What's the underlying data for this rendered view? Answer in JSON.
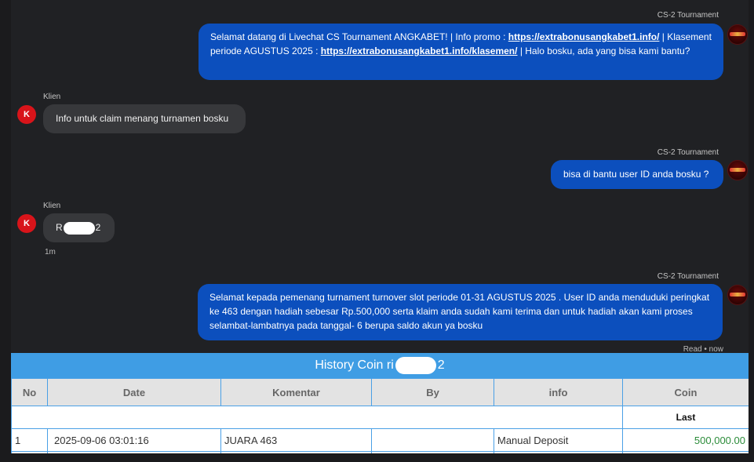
{
  "chat": {
    "messages": [
      {
        "role": "agent",
        "sender": "CS-2 Tournament",
        "parts": {
          "p1": "Selamat datang di Livechat CS Tournament ANGKABET! | Info promo : ",
          "link1": "https://extrabonusangkabet1.info/",
          "p2": " | Klasement periode AGUSTUS 2025 : ",
          "link2": "https://extrabonusangkabet1.info/klasemen/",
          "p3": " | Halo bosku, ada yang bisa kami bantu?"
        }
      },
      {
        "role": "client",
        "sender": "Klien",
        "avatar": "K",
        "text": "Info untuk claim menang turnamen bosku"
      },
      {
        "role": "agent",
        "sender": "CS-2 Tournament",
        "text": "bisa di bantu user ID anda bosku ?"
      },
      {
        "role": "client",
        "sender": "Klien",
        "avatar": "K",
        "text_start": "R",
        "text_end": "2",
        "time": "1m"
      },
      {
        "role": "agent",
        "sender": "CS-2 Tournament",
        "text": "Selamat kepada pemenang turnament turnover slot periode 01-31 AGUSTUS 2025 . User ID anda menduduki peringkat ke 463 dengan hadiah sebesar Rp.500,000 serta klaim anda sudah kami terima dan untuk hadiah akan kami proses selambat-lambatnya pada tanggal- 6 berupa saldo akun ya bosku",
        "status": "Read • now"
      }
    ]
  },
  "history": {
    "title_start": "History Coin ri",
    "title_end": "2",
    "columns": [
      "No",
      "Date",
      "Komentar",
      "By",
      "info",
      "Coin"
    ],
    "last_label": "Last",
    "rows": [
      {
        "no": "1",
        "date": "2025-09-06 03:01:16",
        "komentar": "JUARA 463",
        "by": "",
        "info": "Manual Deposit",
        "coin": "500,000.00"
      }
    ]
  },
  "colors": {
    "agent_bubble": "#0c4fbd",
    "client_bubble": "#37383b",
    "header_bar": "#3f9de4",
    "coin_positive": "#2c8c3a",
    "client_avatar": "#d8141a"
  },
  "icons": {
    "agent_avatar": "angkabet-logo-icon",
    "client_avatar": "letter-k-avatar"
  }
}
